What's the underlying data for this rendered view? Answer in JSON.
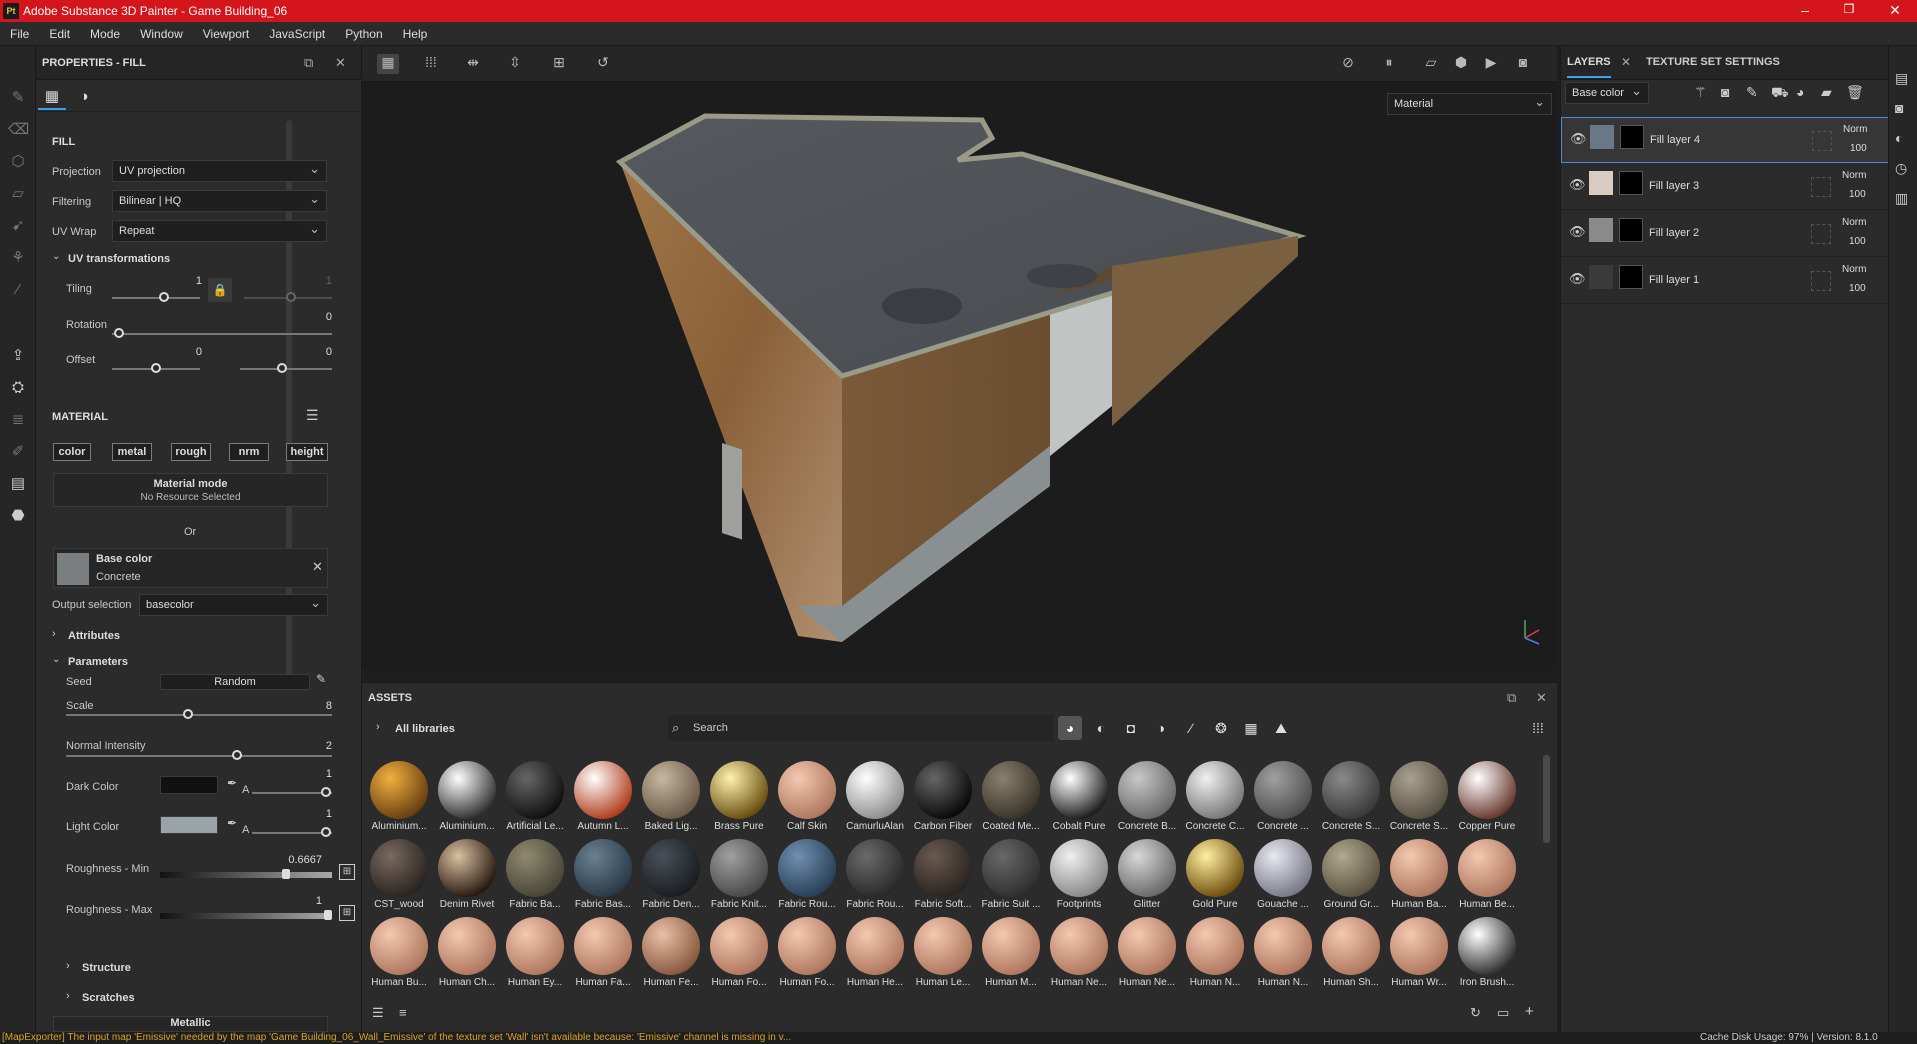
{
  "app": {
    "title": "Adobe Substance 3D Painter - Game Building_06",
    "logo": "Pt"
  },
  "menu": [
    "File",
    "Edit",
    "Mode",
    "Window",
    "Viewport",
    "JavaScript",
    "Python",
    "Help"
  ],
  "properties": {
    "title": "PROPERTIES - FILL",
    "fill_header": "FILL",
    "projection_label": "Projection",
    "projection_value": "UV projection",
    "filtering_label": "Filtering",
    "filtering_value": "Bilinear | HQ",
    "uvwrap_label": "UV Wrap",
    "uvwrap_value": "Repeat",
    "uvtrans_header": "UV transformations",
    "tiling_label": "Tiling",
    "tiling_value": "1",
    "tiling_value2": "1",
    "rotation_label": "Rotation",
    "rotation_value": "0",
    "offset_label": "Offset",
    "offset_value1": "0",
    "offset_value2": "0",
    "material_header": "MATERIAL",
    "channels": [
      "color",
      "metal",
      "rough",
      "nrm",
      "height"
    ],
    "material_mode": "Material mode",
    "no_resource": "No Resource Selected",
    "or": "Or",
    "base_color_title": "Base color",
    "base_color_sub": "Concrete",
    "output_label": "Output selection",
    "output_value": "basecolor",
    "attributes": "Attributes",
    "parameters": "Parameters",
    "seed_label": "Seed",
    "seed_value": "Random",
    "scale_label": "Scale",
    "scale_value": "8",
    "normal_label": "Normal Intensity",
    "normal_value": "2",
    "dark_label": "Dark Color",
    "dark_a": "A",
    "dark_val": "1",
    "light_label": "Light Color",
    "light_a": "A",
    "light_val": "1",
    "rmin_label": "Roughness - Min",
    "rmin_value": "0.6667",
    "rmax_label": "Roughness - Max",
    "rmax_value": "1",
    "structure": "Structure",
    "scratches": "Scratches",
    "metallic": "Metallic"
  },
  "viewport": {
    "material_dropdown": "Material"
  },
  "assets": {
    "title": "ASSETS",
    "libraries": "All libraries",
    "search_placeholder": "Search",
    "row1": [
      {
        "name": "Aluminium...",
        "c1": "#f0b040",
        "c2": "#6a4010"
      },
      {
        "name": "Aluminium...",
        "c1": "#ffffff",
        "c2": "#333333"
      },
      {
        "name": "Artificial Le...",
        "c1": "#666666",
        "c2": "#111111"
      },
      {
        "name": "Autumn L...",
        "c1": "#ffffff",
        "c2": "#b04020"
      },
      {
        "name": "Baked Lig...",
        "c1": "#c8b8a0",
        "c2": "#6a5a48"
      },
      {
        "name": "Brass Pure",
        "c1": "#fff2b0",
        "c2": "#6a5010"
      },
      {
        "name": "Calf Skin",
        "c1": "#f4c8b0",
        "c2": "#b07860"
      },
      {
        "name": "CamurluAlan",
        "c1": "#ffffff",
        "c2": "#909090"
      },
      {
        "name": "Carbon Fiber",
        "c1": "#666666",
        "c2": "#0a0a0a"
      },
      {
        "name": "Coated Me...",
        "c1": "#8a8070",
        "c2": "#3a3528"
      },
      {
        "name": "Cobalt Pure",
        "c1": "#ffffff",
        "c2": "#202020"
      },
      {
        "name": "Concrete B...",
        "c1": "#c8c8c8",
        "c2": "#6a6a6a"
      },
      {
        "name": "Concrete C...",
        "c1": "#f0f0f0",
        "c2": "#7a7a7a"
      },
      {
        "name": "Concrete ...",
        "c1": "#a0a0a0",
        "c2": "#505050"
      },
      {
        "name": "Concrete S...",
        "c1": "#8a8a8a",
        "c2": "#3a3a3a"
      },
      {
        "name": "Concrete S...",
        "c1": "#a8a090",
        "c2": "#585040"
      },
      {
        "name": "Copper Pure",
        "c1": "#ffffff",
        "c2": "#6a3a30"
      }
    ],
    "row2": [
      {
        "name": "CST_wood",
        "c1": "#7a6a60",
        "c2": "#2a2420"
      },
      {
        "name": "Denim Rivet",
        "c1": "#d8c0a0",
        "c2": "#2a1a10"
      },
      {
        "name": "Fabric Ba...",
        "c1": "#908a70",
        "c2": "#4a4638"
      },
      {
        "name": "Fabric Bas...",
        "c1": "#6a8090",
        "c2": "#2a3a48"
      },
      {
        "name": "Fabric Den...",
        "c1": "#4a5058",
        "c2": "#1a1e22"
      },
      {
        "name": "Fabric Knit...",
        "c1": "#a0a0a0",
        "c2": "#4a4a4a"
      },
      {
        "name": "Fabric Rou...",
        "c1": "#7090b0",
        "c2": "#2a4058"
      },
      {
        "name": "Fabric Rou...",
        "c1": "#6a6a6a",
        "c2": "#2a2a2a"
      },
      {
        "name": "Fabric Soft...",
        "c1": "#6a5a50",
        "c2": "#2a2420"
      },
      {
        "name": "Fabric Suit ...",
        "c1": "#686868",
        "c2": "#303030"
      },
      {
        "name": "Footprints",
        "c1": "#f0f0f0",
        "c2": "#8a8a8a"
      },
      {
        "name": "Glitter",
        "c1": "#d8d8d8",
        "c2": "#6a6a6a"
      },
      {
        "name": "Gold Pure",
        "c1": "#fff0a0",
        "c2": "#705010"
      },
      {
        "name": "Gouache ...",
        "c1": "#e8e8f0",
        "c2": "#7a7a88"
      },
      {
        "name": "Ground Gr...",
        "c1": "#b0a890",
        "c2": "#5a5440"
      },
      {
        "name": "Human Ba...",
        "c1": "#f4c8b0",
        "c2": "#b07860"
      },
      {
        "name": "Human Be...",
        "c1": "#f4c8b0",
        "c2": "#b07860"
      }
    ],
    "row3": [
      {
        "name": "Human Bu...",
        "c1": "#f4c8b0",
        "c2": "#b07860"
      },
      {
        "name": "Human Ch...",
        "c1": "#f4c8b0",
        "c2": "#b07860"
      },
      {
        "name": "Human Ey...",
        "c1": "#f4c8b0",
        "c2": "#b07860"
      },
      {
        "name": "Human Fa...",
        "c1": "#f4c8b0",
        "c2": "#b07860"
      },
      {
        "name": "Human Fe...",
        "c1": "#e8c0a8",
        "c2": "#8a5a40"
      },
      {
        "name": "Human Fo...",
        "c1": "#f4c8b0",
        "c2": "#b07860"
      },
      {
        "name": "Human Fo...",
        "c1": "#f4c8b0",
        "c2": "#b07860"
      },
      {
        "name": "Human He...",
        "c1": "#f4c8b0",
        "c2": "#b07860"
      },
      {
        "name": "Human Le...",
        "c1": "#f4c8b0",
        "c2": "#b07860"
      },
      {
        "name": "Human M...",
        "c1": "#f4c8b0",
        "c2": "#b07860"
      },
      {
        "name": "Human Ne...",
        "c1": "#f4c8b0",
        "c2": "#b07860"
      },
      {
        "name": "Human Ne...",
        "c1": "#f4c8b0",
        "c2": "#b07860"
      },
      {
        "name": "Human N...",
        "c1": "#f4c8b0",
        "c2": "#b07860"
      },
      {
        "name": "Human N...",
        "c1": "#f4c8b0",
        "c2": "#b07860"
      },
      {
        "name": "Human Sh...",
        "c1": "#f4c8b0",
        "c2": "#b07860"
      },
      {
        "name": "Human Wr...",
        "c1": "#f4c8b0",
        "c2": "#b07860"
      },
      {
        "name": "Iron Brush...",
        "c1": "#ffffff",
        "c2": "#303030"
      }
    ]
  },
  "layers": {
    "tab_layers": "LAYERS",
    "tab_tss": "TEXTURE SET SETTINGS",
    "channel_dropdown": "Base color",
    "items": [
      {
        "name": "Fill layer 4",
        "blend": "Norm",
        "opacity": "100",
        "thumb": "#6a7888"
      },
      {
        "name": "Fill layer 3",
        "blend": "Norm",
        "opacity": "100",
        "thumb": "#d8ccc0"
      },
      {
        "name": "Fill layer 2",
        "blend": "Norm",
        "opacity": "100",
        "thumb": "#8a8a8a"
      },
      {
        "name": "Fill layer 1",
        "blend": "Norm",
        "opacity": "100",
        "thumb": "#3a3a3a"
      }
    ]
  },
  "status": {
    "message": "[MapExporter] The input map 'Emissive' needed by the map 'Game Building_06_Wall_Emissive' of the texture set 'Wall' isn't available because: 'Emissive' channel is missing in v...",
    "cache": "Cache Disk Usage:   97% | Version: 8.1.0"
  },
  "colors": {
    "accent": "#3aa0f0",
    "title_red": "#d5151c",
    "status_warn": "#e0a020"
  }
}
